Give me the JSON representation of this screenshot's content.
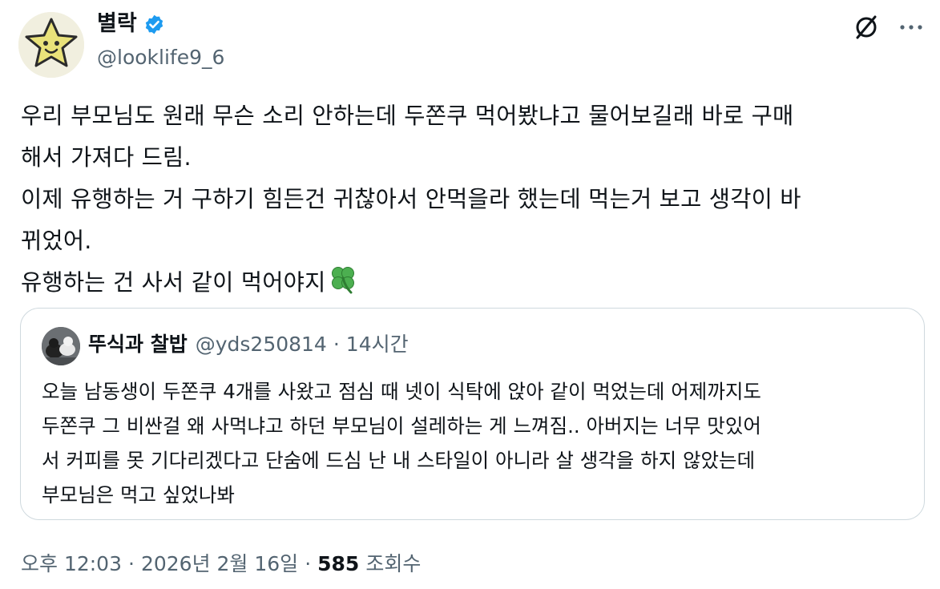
{
  "author": {
    "display_name": "별락",
    "handle": "@looklife9_6",
    "verified": true
  },
  "icons": {
    "grok": "grok-slash-circle-icon",
    "more": "more-dots-icon",
    "verified": "verified-badge-icon",
    "clover": "four-leaf-clover-emoji"
  },
  "tweet": {
    "text": "우리 부모님도 원래 무슨 소리 안하는데 두쫀쿠 먹어봤냐고 물어보길래 바로 구매\n해서 가져다 드림.\n이제 유행하는 거 구하기 힘든건 귀찮아서 안먹을라 했는데 먹는거 보고 생각이 바\n뀌었어.\n유행하는 건 사서 같이 먹어야지"
  },
  "quote": {
    "display_name": "뚜식과 찰밥",
    "handle": "@yds250814",
    "separator": "·",
    "time": "14시간",
    "text": "오늘 남동생이 두쫀쿠 4개를 사왔고 점심 때 넷이 식탁에 앉아 같이 먹었는데 어제까지도\n두쫀쿠 그 비싼걸 왜 사먹냐고 하던 부모님이 설레하는 게 느껴짐.. 아버지는 너무 맛있어\n서 커피를 못 기다리겠다고 단숨에 드심 난 내 스타일이 아니라 살 생각을 하지 않았는데\n부모님은 먹고 싶었나봐"
  },
  "meta": {
    "time": "오후 12:03",
    "separator": "·",
    "date": "2026년 2월 16일",
    "views_count": "585",
    "views_label": "조회수"
  },
  "colors": {
    "text": "#0f1419",
    "secondary": "#536471",
    "verified": "#1d9bf0",
    "border": "#cfd9de",
    "star": "#e8e07a"
  }
}
